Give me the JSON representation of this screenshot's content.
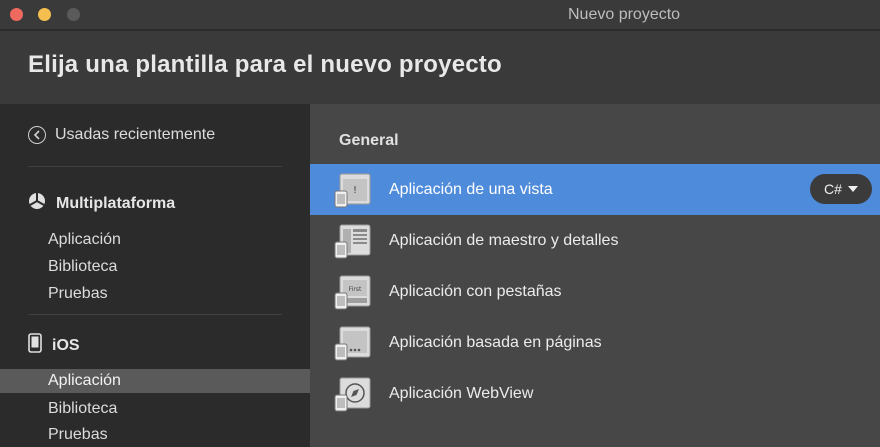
{
  "window": {
    "title": "Nuevo proyecto"
  },
  "header": {
    "title": "Elija una plantilla para el nuevo proyecto"
  },
  "sidebar": {
    "recent_label": "Usadas recientemente",
    "groups": [
      {
        "title": "Multiplataforma",
        "icon": "multiplatform-icon",
        "items": [
          "Aplicación",
          "Biblioteca",
          "Pruebas"
        ]
      },
      {
        "title": "iOS",
        "icon": "phone-icon",
        "items": [
          "Aplicación",
          "Biblioteca",
          "Pruebas"
        ],
        "selected": "Aplicación"
      }
    ]
  },
  "main": {
    "section": "General",
    "templates": [
      {
        "label": "Aplicación de una vista",
        "icon": "single-view-icon",
        "selected": true
      },
      {
        "label": "Aplicación de maestro y detalles",
        "icon": "master-detail-icon"
      },
      {
        "label": "Aplicación con pestañas",
        "icon": "tabbed-icon",
        "tab_text": "First"
      },
      {
        "label": "Aplicación basada en páginas",
        "icon": "page-based-icon"
      },
      {
        "label": "Aplicación WebView",
        "icon": "webview-icon"
      }
    ],
    "language": "C#"
  },
  "colors": {
    "selection": "#4f8bdb",
    "sidebar_selection": "#5a5a5a",
    "background": "#2b2b2b",
    "main_background": "#474747"
  }
}
